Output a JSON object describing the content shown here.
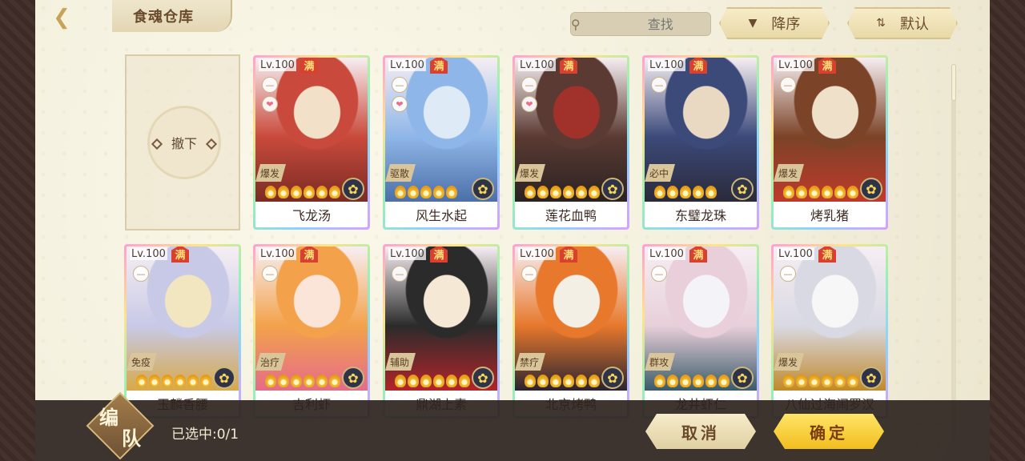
{
  "header": {
    "title": "食魂仓库",
    "search_placeholder": "查找",
    "sort_order_label": "降序",
    "sort_mode_label": "默认"
  },
  "remove_slot": {
    "label": "撤下"
  },
  "cards": [
    {
      "level": "Lv.100",
      "badge": "满",
      "role": "爆发",
      "name": "飞龙汤",
      "stars": 6,
      "has_heart": true,
      "colors": [
        "#c94a3c",
        "#f3e0c8",
        "#7a2b24"
      ]
    },
    {
      "level": "Lv.100",
      "badge": "满",
      "role": "驱散",
      "name": "风生水起",
      "stars": 5,
      "has_heart": true,
      "colors": [
        "#8fb6e8",
        "#dfeaf7",
        "#4b6fa8"
      ]
    },
    {
      "level": "Lv.100",
      "badge": "满",
      "role": "爆发",
      "name": "莲花血鸭",
      "stars": 6,
      "has_heart": true,
      "colors": [
        "#5a3a32",
        "#a0312b",
        "#2b2222"
      ]
    },
    {
      "level": "Lv.100",
      "badge": "满",
      "role": "必中",
      "name": "东璧龙珠",
      "stars": 5,
      "has_heart": false,
      "colors": [
        "#3c4a7a",
        "#e9d9c3",
        "#2a2a3a"
      ]
    },
    {
      "level": "Lv.100",
      "badge": "满",
      "role": "爆发",
      "name": "烤乳猪",
      "stars": 6,
      "has_heart": false,
      "colors": [
        "#7b4327",
        "#efe1c9",
        "#c0392b"
      ]
    },
    {
      "level": "Lv.100",
      "badge": "满",
      "role": "免疫",
      "name": "玉麟香腰",
      "stars": 6,
      "has_heart": false,
      "colors": [
        "#c7c9e6",
        "#f1e6c0",
        "#d7a94a"
      ]
    },
    {
      "level": "Lv.100",
      "badge": "满",
      "role": "治疗",
      "name": "吉利虾",
      "stars": 6,
      "has_heart": false,
      "colors": [
        "#f3a24b",
        "#fbe5d9",
        "#e56b8a"
      ]
    },
    {
      "level": "Lv.100",
      "badge": "满",
      "role": "辅助",
      "name": "鼎湖上素",
      "stars": 6,
      "has_heart": false,
      "colors": [
        "#2b2b2b",
        "#f5e9d5",
        "#b3242a"
      ]
    },
    {
      "level": "Lv.100",
      "badge": "满",
      "role": "禁疗",
      "name": "北京烤鸭",
      "stars": 6,
      "has_heart": false,
      "colors": [
        "#e7782c",
        "#f4efe4",
        "#2a2430"
      ]
    },
    {
      "level": "Lv.100",
      "badge": "满",
      "role": "群攻",
      "name": "龙井虾仁",
      "stars": 6,
      "has_heart": false,
      "colors": [
        "#e8cfd9",
        "#f4f4f8",
        "#3a5a6a"
      ]
    },
    {
      "level": "Lv.100",
      "badge": "满",
      "role": "爆发",
      "name": "八仙过海闹罗汉",
      "stars": 6,
      "has_heart": false,
      "colors": [
        "#d9d9e3",
        "#f7f7f7",
        "#c08a2a"
      ]
    }
  ],
  "footer": {
    "team_char1": "编",
    "team_char2": "队",
    "selected_text": "已选中:0/1",
    "cancel_label": "取消",
    "confirm_label": "确定"
  }
}
